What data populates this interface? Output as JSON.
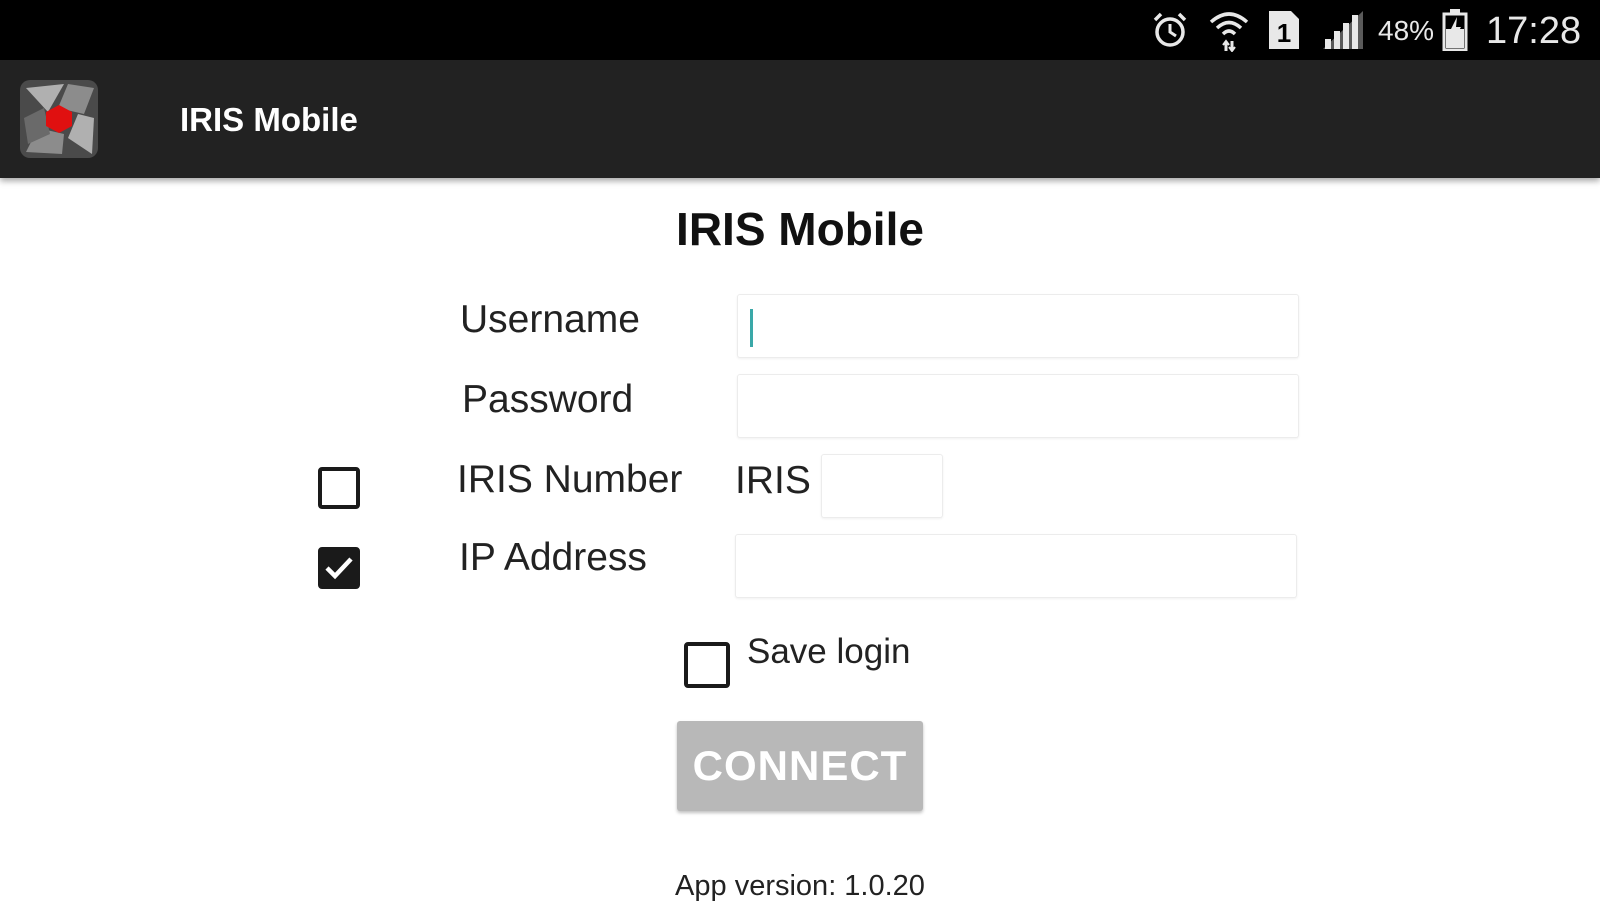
{
  "status_bar": {
    "icons": [
      "alarm-icon",
      "wifi-icon",
      "sim-1-icon",
      "signal-icon",
      "battery-icon"
    ],
    "sim_slot": "1",
    "battery_percent": "48%",
    "time": "17:28"
  },
  "action_bar": {
    "title": "IRIS Mobile",
    "logo_colors": {
      "accent": "#e01010",
      "blade_light": "#b0b0b0",
      "blade_dark": "#5a5a5a"
    }
  },
  "form": {
    "title": "IRIS Mobile",
    "username_label": "Username",
    "username_value": "",
    "password_label": "Password",
    "password_value": "",
    "iris_number_label": "IRIS Number",
    "iris_number_checked": false,
    "iris_prefix": "IRIS",
    "iris_number_value": "",
    "ip_address_label": "IP Address",
    "ip_address_checked": true,
    "ip_address_value": "",
    "save_login_label": "Save login",
    "save_login_checked": false,
    "connect_label": "CONNECT"
  },
  "footer": {
    "version_text": "App version: 1.0.20"
  },
  "colors": {
    "status_bar_bg": "#000000",
    "action_bar_bg": "#222222",
    "button_disabled_bg": "#b8b8b8",
    "cursor": "#3aa8a8"
  }
}
